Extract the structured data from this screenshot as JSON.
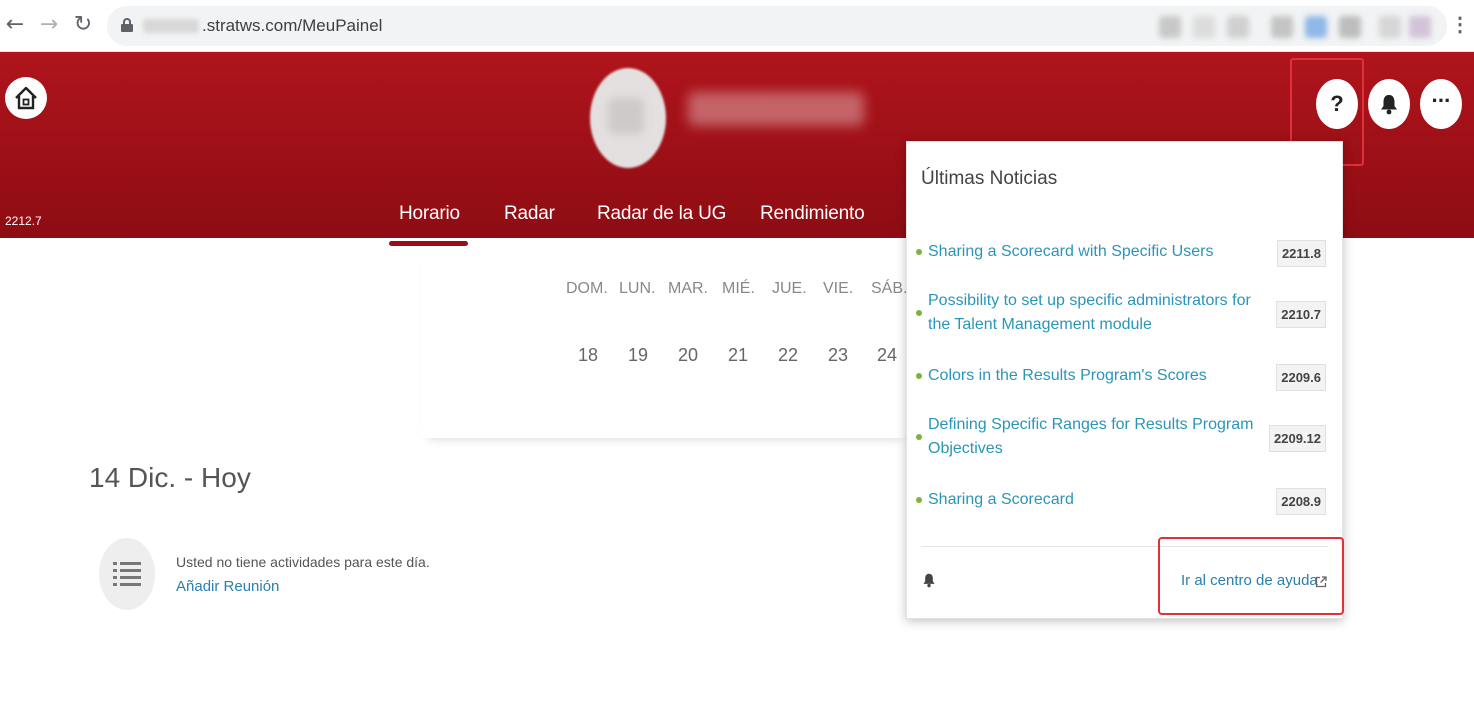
{
  "browser": {
    "url_text": ".stratws.com/MeuPainel",
    "back_icon": "arrow-left-icon",
    "forward_icon": "arrow-right-icon",
    "reload_icon": "reload-icon"
  },
  "header": {
    "version": "2212.7",
    "tabs": [
      {
        "label": "Horario",
        "active": true
      },
      {
        "label": "Radar"
      },
      {
        "label": "Radar de la UG"
      },
      {
        "label": "Rendimiento"
      }
    ],
    "help_label": "?",
    "more_label": "···",
    "colors": {
      "header": "#a0121a",
      "accent": "#9a0f16"
    }
  },
  "calendar": {
    "days": [
      "DOM.",
      "LUN.",
      "MAR.",
      "MIÉ.",
      "JUE.",
      "VIE.",
      "SÁB."
    ],
    "dates": [
      "18",
      "19",
      "20",
      "21",
      "22",
      "23",
      "24"
    ]
  },
  "agenda": {
    "title": "14 Dic. - Hoy",
    "empty_text": "Usted no tiene actividades para este día.",
    "add_meeting": "Añadir Reunión"
  },
  "news": {
    "title": "Últimas Noticias",
    "items": [
      {
        "text": "Sharing a Scorecard with Specific Users",
        "version": "2211.8"
      },
      {
        "text": "Possibility to set up specific administrators for the Talent Management module",
        "version": "2210.7"
      },
      {
        "text": "Colors in the Results Program's Scores",
        "version": "2209.6"
      },
      {
        "text": "Defining Specific Ranges for Results Program Objectives",
        "version": "2209.12"
      },
      {
        "text": "Sharing a Scorecard",
        "version": "2208.9"
      }
    ],
    "help_center": "Ir al centro de ayuda"
  }
}
